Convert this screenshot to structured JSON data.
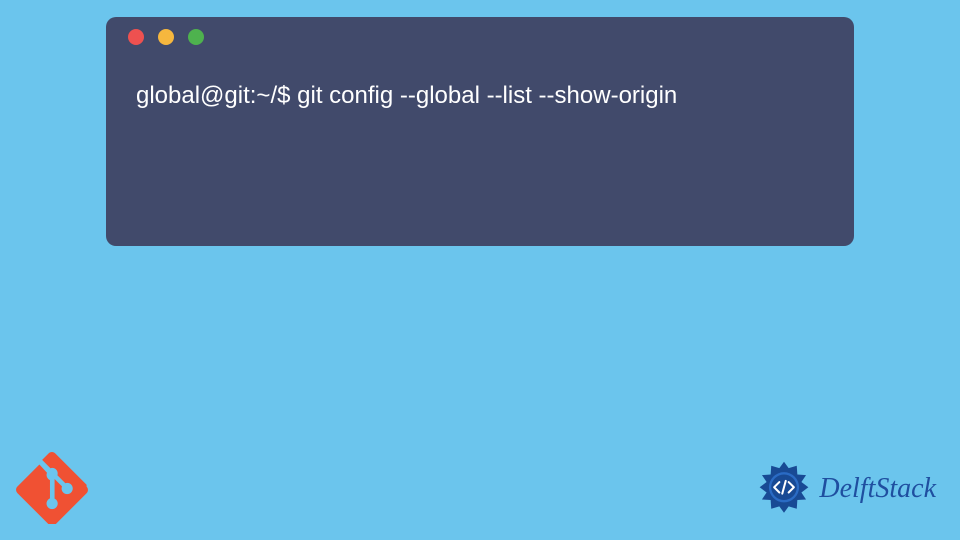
{
  "terminal": {
    "prompt": "global@git:~/$",
    "command": "git config --global --list --show-origin"
  },
  "brand": {
    "name": "DelftStack"
  },
  "colors": {
    "background": "#6bc5ed",
    "terminal": "#414a6b",
    "traffic_red": "#ee5150",
    "traffic_yellow": "#f6b73e",
    "traffic_green": "#4eb24e",
    "git_orange": "#f05133",
    "brand_blue": "#1f4fa0"
  }
}
